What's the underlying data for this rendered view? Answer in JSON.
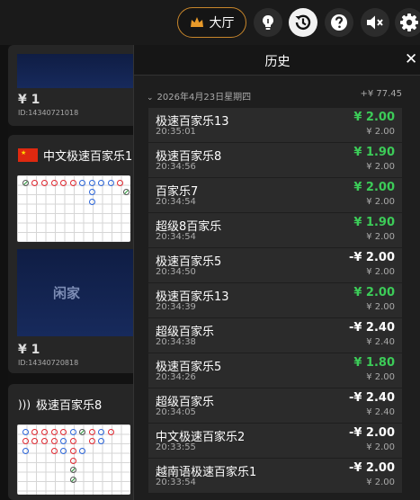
{
  "topbar": {
    "lobby_label": "大厅",
    "lobby_icon": "crown-icon",
    "buttons": [
      "lightbulb-icon",
      "history-icon",
      "help-icon",
      "mute-icon",
      "gear-icon"
    ]
  },
  "lobby": {
    "card1": {
      "price": "¥ 1",
      "table_id": "ID:14340721018"
    },
    "card2": {
      "title": "中文极速百家乐1",
      "flag": "china-flag-icon",
      "banner": "闲家",
      "price": "¥ 1",
      "table_id": "ID:14340720818"
    },
    "card3": {
      "title": "极速百家乐8",
      "icon": "live-signal-icon"
    }
  },
  "history": {
    "title": "历史",
    "date": "2026年4月23日星期四",
    "total": "+¥ 77.45",
    "entries": [
      {
        "name": "极速百家乐13",
        "time": "20:35:01",
        "amount": "¥ 2.00",
        "result": "win",
        "stake": "¥ 2.00"
      },
      {
        "name": "极速百家乐8",
        "time": "20:34:56",
        "amount": "¥ 1.90",
        "result": "win",
        "stake": "¥ 2.00"
      },
      {
        "name": "百家乐7",
        "time": "20:34:54",
        "amount": "¥ 2.00",
        "result": "win",
        "stake": "¥ 2.00"
      },
      {
        "name": "超级8百家乐",
        "time": "20:34:54",
        "amount": "¥ 1.90",
        "result": "win",
        "stake": "¥ 2.00"
      },
      {
        "name": "极速百家乐5",
        "time": "20:34:50",
        "amount": "-¥ 2.00",
        "result": "loss",
        "stake": "¥ 2.00"
      },
      {
        "name": "极速百家乐13",
        "time": "20:34:39",
        "amount": "¥ 2.00",
        "result": "win",
        "stake": "¥ 2.00"
      },
      {
        "name": "超级百家乐",
        "time": "20:34:38",
        "amount": "-¥ 2.40",
        "result": "loss",
        "stake": "¥ 2.40"
      },
      {
        "name": "极速百家乐5",
        "time": "20:34:26",
        "amount": "¥ 1.80",
        "result": "win",
        "stake": "¥ 2.00"
      },
      {
        "name": "超级百家乐",
        "time": "20:34:05",
        "amount": "-¥ 2.40",
        "result": "loss",
        "stake": "¥ 2.40"
      },
      {
        "name": "中文极速百家乐2",
        "time": "20:33:55",
        "amount": "-¥ 2.00",
        "result": "loss",
        "stake": "¥ 2.00"
      },
      {
        "name": "越南语极速百家乐1",
        "time": "20:33:54",
        "amount": "-¥ 2.00",
        "result": "loss",
        "stake": "¥ 2.00"
      }
    ]
  },
  "colors": {
    "win": "#3ccc58",
    "accent": "#c8862b"
  }
}
